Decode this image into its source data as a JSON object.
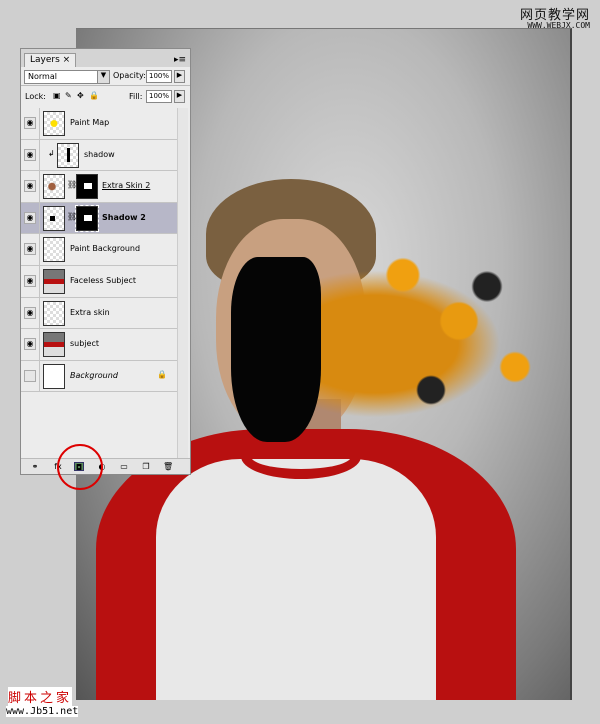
{
  "panel": {
    "tab": "Layers",
    "blend_mode": "Normal",
    "opacity_label": "Opacity:",
    "opacity": "100%",
    "lock_label": "Lock:",
    "fill_label": "Fill:",
    "fill": "100%"
  },
  "layers": [
    {
      "name": "Paint Map",
      "visible": true
    },
    {
      "name": "shadow",
      "visible": true,
      "clipped": true
    },
    {
      "name": "Extra Skin 2",
      "visible": true,
      "mask": true
    },
    {
      "name": "Shadow 2",
      "visible": true,
      "mask": true,
      "selected": true
    },
    {
      "name": "Paint Background",
      "visible": true
    },
    {
      "name": "Faceless Subject",
      "visible": true
    },
    {
      "name": "Extra skin",
      "visible": true
    },
    {
      "name": "subject",
      "visible": true
    },
    {
      "name": "Background",
      "visible": false,
      "locked": true
    }
  ],
  "watermarks": {
    "top_cn": "网页教学网",
    "top_url": "WWW.WEBJX.COM",
    "bottom_cn": "脚本之家",
    "bottom_url": "www.Jb51.net"
  },
  "colors": {
    "highlight": "#d00000",
    "selected_row": "#b7b7c8",
    "paint": "#f0a010"
  }
}
